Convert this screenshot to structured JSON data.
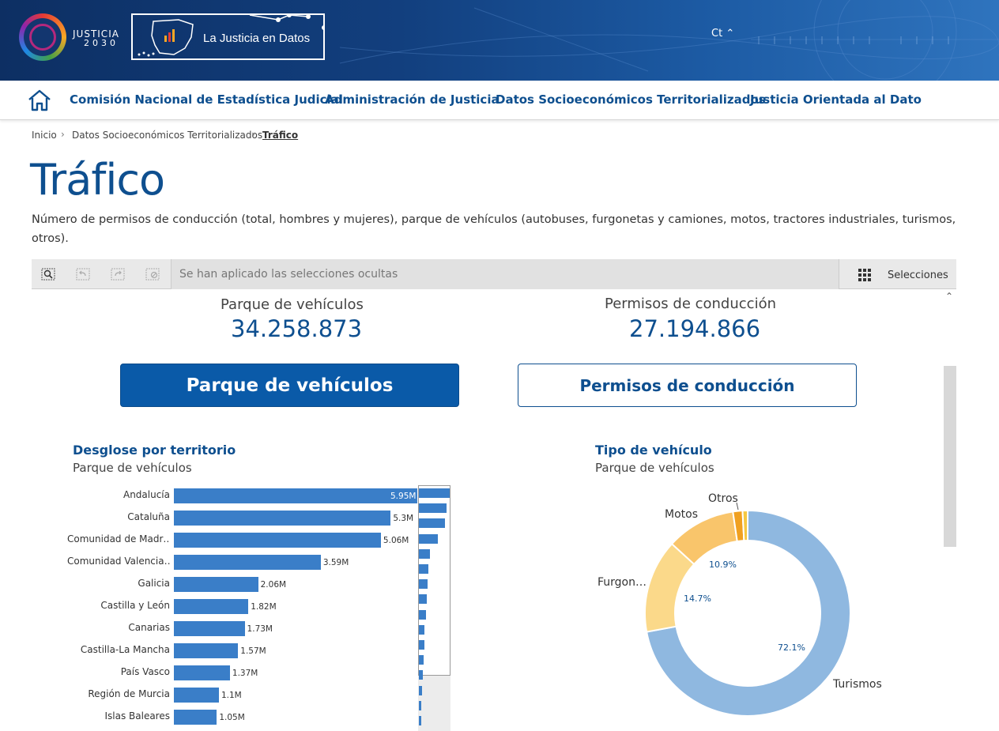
{
  "header": {
    "logo_text_top": "JUSTICIA",
    "logo_text_bottom": "2030",
    "brand": "La Justicia en Datos",
    "language": "Ct"
  },
  "nav": {
    "items": [
      "Comisión Nacional de Estadística Judicial",
      "Administración de Justicia",
      "Datos Socioeconómicos Territorializados",
      "Justicia Orientada al Dato"
    ]
  },
  "breadcrumb": [
    "Inicio",
    "Datos Socioeconómicos Territorializados",
    "Tráfico"
  ],
  "page": {
    "title": "Tráfico",
    "description": "Número de permisos de conducción (total, hombres y mujeres), parque de vehículos (autobuses, furgonetas y camiones, motos, tractores industriales, turismos, otros)."
  },
  "toolbar": {
    "message": "Se han aplicado las selecciones ocultas",
    "selections_label": "Selecciones"
  },
  "kpis": [
    {
      "label": "Parque de vehículos",
      "value": "34.258.873"
    },
    {
      "label": "Permisos de conducción",
      "value": "27.194.866"
    }
  ],
  "buttons": {
    "vehicles": "Parque de vehículos",
    "licenses": "Permisos de conducción"
  },
  "colors": {
    "primary": "#0a5aa8",
    "bar": "#3a7ec8"
  },
  "chart_data": [
    {
      "type": "bar",
      "orientation": "horizontal",
      "title": "Desglose por territorio",
      "subtitle": "Parque de vehículos",
      "categories": [
        "Andalucía",
        "Cataluña",
        "Comunidad de Madr…",
        "Comunidad Valencia…",
        "Galicia",
        "Castilla y León",
        "Canarias",
        "Castilla-La Mancha",
        "País Vasco",
        "Región de Murcia",
        "Islas Baleares"
      ],
      "values": [
        5.95,
        5.3,
        5.06,
        3.59,
        2.06,
        1.82,
        1.73,
        1.57,
        1.37,
        1.1,
        1.05
      ],
      "value_labels": [
        "5.95M",
        "5.3M",
        "5.06M",
        "3.59M",
        "2.06M",
        "1.82M",
        "1.73M",
        "1.57M",
        "1.37M",
        "1.1M",
        "1.05M"
      ],
      "unit": "M"
    },
    {
      "type": "pie",
      "variant": "donut",
      "title": "Tipo de vehículo",
      "subtitle": "Parque de vehículos",
      "slices": [
        {
          "name": "Turismos",
          "value": 72.1,
          "label": "72.1%",
          "color": "#8fb8e0"
        },
        {
          "name": "Furgon…",
          "value": 14.7,
          "label": "14.7%",
          "color": "#fbd98a"
        },
        {
          "name": "Motos",
          "value": 10.9,
          "label": "10.9%",
          "color": "#f9c56b"
        },
        {
          "name": "",
          "value": 1.5,
          "label": "",
          "color": "#f0a020"
        },
        {
          "name": "Otros",
          "value": 0.8,
          "label": "",
          "color": "#f5c842"
        }
      ]
    }
  ]
}
